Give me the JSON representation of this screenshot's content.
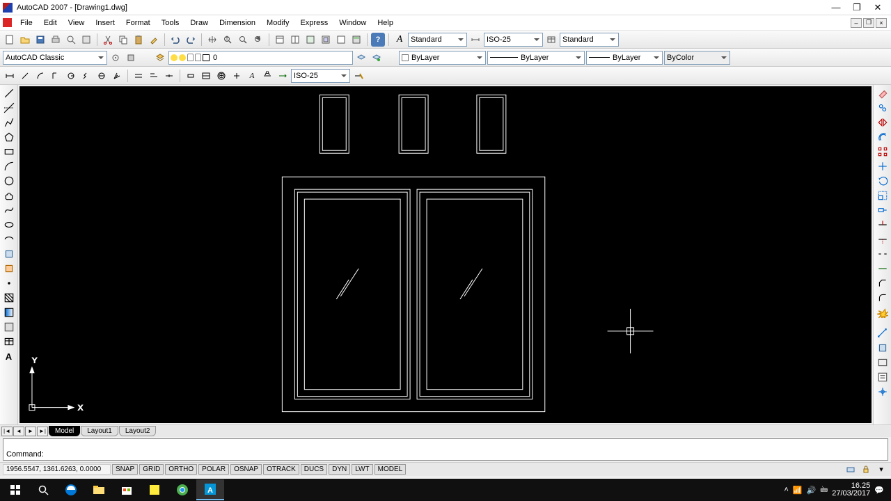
{
  "window": {
    "title": "AutoCAD 2007 - [Drawing1.dwg]"
  },
  "menubar": [
    "File",
    "Edit",
    "View",
    "Insert",
    "Format",
    "Tools",
    "Draw",
    "Dimension",
    "Modify",
    "Express",
    "Window",
    "Help"
  ],
  "workspace_dd": "AutoCAD Classic",
  "layer_name": "0",
  "style_dd1": "Standard",
  "style_dd2": "ISO-25",
  "style_dd3": "Standard",
  "prop_color": "ByLayer",
  "prop_ltype": "ByLayer",
  "prop_lweight": "ByLayer",
  "prop_plotstyle": "ByColor",
  "dimstyle_dd": "ISO-25",
  "ucs": {
    "x": "X",
    "y": "Y"
  },
  "tabs": {
    "model": "Model",
    "l1": "Layout1",
    "l2": "Layout2"
  },
  "command_prompt": "Command:",
  "status": {
    "coords": "1956.5547, 1361.6263, 0.0000",
    "toggles": [
      "SNAP",
      "GRID",
      "ORTHO",
      "POLAR",
      "OSNAP",
      "OTRACK",
      "DUCS",
      "DYN",
      "LWT",
      "MODEL"
    ]
  },
  "clock": {
    "time": "16.25",
    "date": "27/03/2017"
  }
}
